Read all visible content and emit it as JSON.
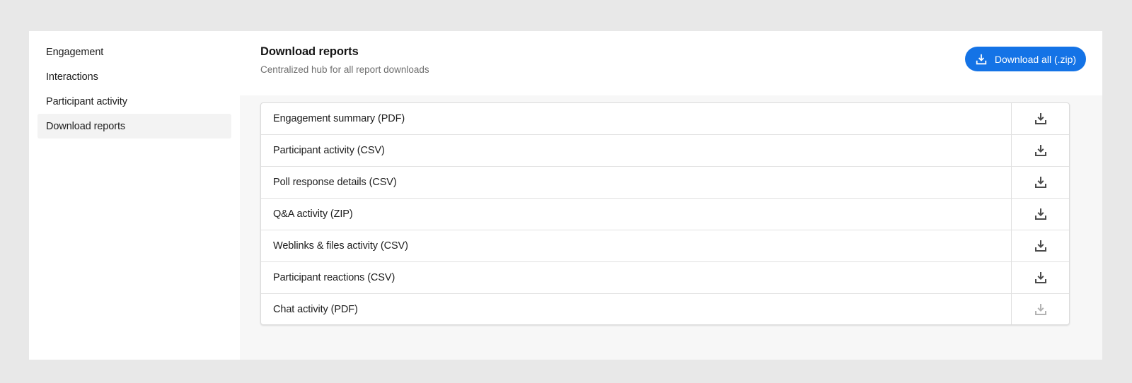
{
  "sidebar": {
    "items": [
      {
        "label": "Engagement",
        "active": false
      },
      {
        "label": "Interactions",
        "active": false
      },
      {
        "label": "Participant activity",
        "active": false
      },
      {
        "label": "Download reports",
        "active": true
      }
    ]
  },
  "header": {
    "title": "Download reports",
    "subtitle": "Centralized hub for all report downloads",
    "download_all_label": "Download all (.zip)",
    "download_all_icon": "download-icon"
  },
  "colors": {
    "accent": "#1473e6",
    "icon_enabled": "#4b4b4b",
    "icon_disabled": "#b3b3b3"
  },
  "reports": [
    {
      "label": "Engagement summary (PDF)",
      "enabled": true,
      "icon": "download-icon"
    },
    {
      "label": "Participant activity (CSV)",
      "enabled": true,
      "icon": "download-icon"
    },
    {
      "label": "Poll response details (CSV)",
      "enabled": true,
      "icon": "download-icon"
    },
    {
      "label": "Q&A activity (ZIP)",
      "enabled": true,
      "icon": "download-icon"
    },
    {
      "label": "Weblinks & files activity (CSV)",
      "enabled": true,
      "icon": "download-icon"
    },
    {
      "label": "Participant reactions (CSV)",
      "enabled": true,
      "icon": "download-icon"
    },
    {
      "label": "Chat activity (PDF)",
      "enabled": false,
      "icon": "download-icon"
    }
  ]
}
